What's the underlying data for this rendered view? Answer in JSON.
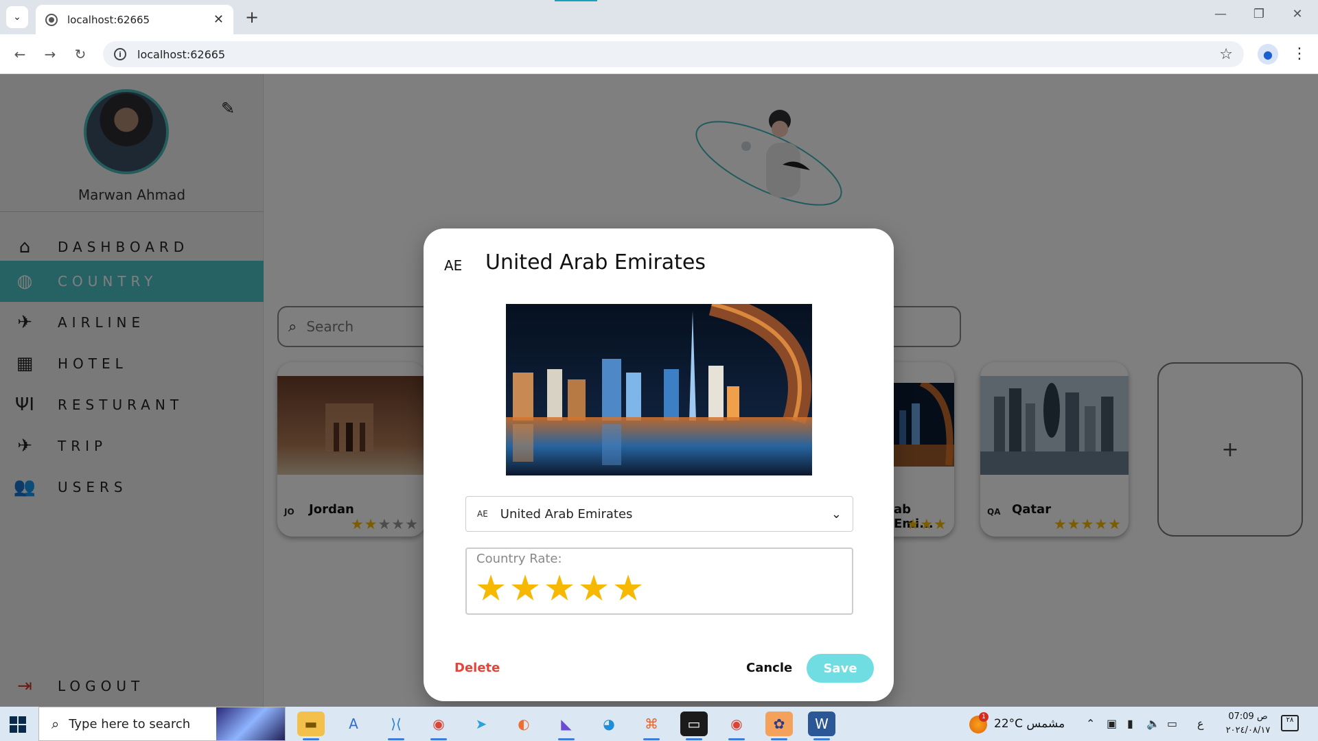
{
  "browser": {
    "tab_title": "localhost:62665",
    "url": "localhost:62665"
  },
  "sidebar": {
    "user_name": "Marwan Ahmad",
    "items": [
      {
        "label": "DASHBOARD",
        "icon": "home-icon"
      },
      {
        "label": "COUNTRY",
        "icon": "globe-icon",
        "active": true
      },
      {
        "label": "AIRLINE",
        "icon": "airplane-icon"
      },
      {
        "label": "HOTEL",
        "icon": "building-icon"
      },
      {
        "label": "RESTURANT",
        "icon": "fork-knife-icon"
      },
      {
        "label": "TRIP",
        "icon": "flight-takeoff-icon"
      },
      {
        "label": "USERS",
        "icon": "people-icon"
      }
    ],
    "logout_label": "LOGOUT"
  },
  "main": {
    "search_placeholder": "Search",
    "cards": [
      {
        "code": "JO",
        "name": "Jordan",
        "rating": 2
      },
      {
        "code": "",
        "name": "ab Emi...",
        "rating": 5
      },
      {
        "code": "QA",
        "name": "Qatar",
        "rating": 5
      }
    ],
    "add_label": "+"
  },
  "dialog": {
    "code": "AE",
    "title": "United Arab Emirates",
    "select_code": "AE",
    "select_value": "United Arab Emirates",
    "rate_label": "Country Rate:",
    "rating": 5,
    "delete_label": "Delete",
    "cancel_label": "Cancle",
    "save_label": "Save"
  },
  "taskbar": {
    "search_placeholder": "Type here to search",
    "weather": "22°C  مشمس",
    "weather_badge": "1",
    "time": "07:09 ص",
    "date": "٢٠٢٤/٠٨/١٧",
    "lang": "ع",
    "notif_count": "٢٨"
  },
  "colors": {
    "accent": "#4cc3c6",
    "star": "#f6b800",
    "delete": "#e2453a",
    "save_bg": "#6fdde1"
  }
}
